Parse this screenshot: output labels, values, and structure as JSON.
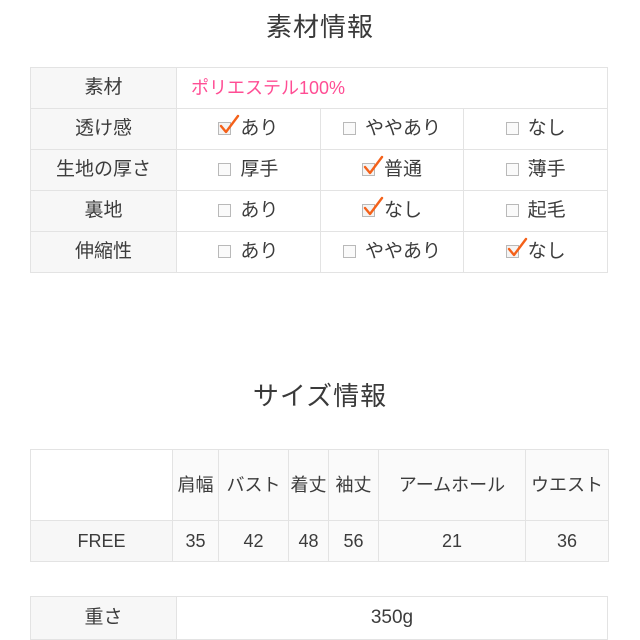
{
  "material_section": {
    "title": "素材情報",
    "rows": [
      {
        "label": "素材",
        "type": "text",
        "value": "ポリエステル100%",
        "value_color": "#ff4d94"
      },
      {
        "label": "透け感",
        "type": "options",
        "options": [
          {
            "label": "あり",
            "checked": true
          },
          {
            "label": "ややあり",
            "checked": false
          },
          {
            "label": "なし",
            "checked": false
          }
        ]
      },
      {
        "label": "生地の厚さ",
        "type": "options",
        "options": [
          {
            "label": "厚手",
            "checked": false
          },
          {
            "label": "普通",
            "checked": true
          },
          {
            "label": "薄手",
            "checked": false
          }
        ]
      },
      {
        "label": "裏地",
        "type": "options",
        "options": [
          {
            "label": "あり",
            "checked": false
          },
          {
            "label": "なし",
            "checked": true
          },
          {
            "label": "起毛",
            "checked": false
          }
        ]
      },
      {
        "label": "伸縮性",
        "type": "options",
        "options": [
          {
            "label": "あり",
            "checked": false
          },
          {
            "label": "ややあり",
            "checked": false
          },
          {
            "label": "なし",
            "checked": true
          }
        ]
      }
    ]
  },
  "size_section": {
    "title": "サイズ情報",
    "corner": "",
    "headers": [
      "肩幅",
      "バスト",
      "着丈",
      "袖丈",
      "アームホール",
      "ウエスト"
    ],
    "rows": [
      {
        "size": "FREE",
        "values": [
          "35",
          "42",
          "48",
          "56",
          "21",
          "36"
        ]
      }
    ]
  },
  "weight_section": {
    "label": "重さ",
    "value": "350g"
  },
  "colors": {
    "check": "#f4611a",
    "accent_pink": "#ff4d94",
    "border": "#e3e3e3",
    "label_bg": "#f7f7f7",
    "text": "#3c3c3c"
  }
}
